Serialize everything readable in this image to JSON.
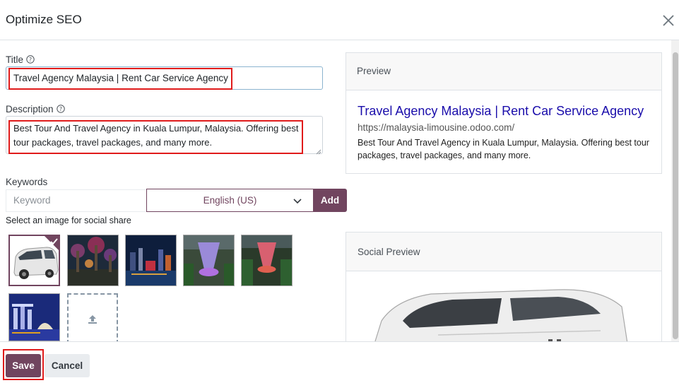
{
  "dialog": {
    "title": "Optimize SEO",
    "close_icon": "close-icon"
  },
  "form": {
    "title_label": "Title",
    "title_value": "Travel Agency Malaysia | Rent Car Service Agency",
    "description_label": "Description",
    "description_value": "Best Tour And Travel Agency in Kuala Lumpur, Malaysia. Offering best tour packages, travel packages, and many more.",
    "help_icon": "question-circle-icon",
    "keywords_label": "Keywords",
    "keyword_placeholder": "Keyword",
    "language_selected": "English (US)",
    "add_label": "Add",
    "image_section_label": "Select an image for social share",
    "images": [
      {
        "name": "white-van",
        "selected": true
      },
      {
        "name": "gardens-by-the-bay-night",
        "selected": false
      },
      {
        "name": "marina-bay-night",
        "selected": false
      },
      {
        "name": "jewel-waterfall-purple",
        "selected": false
      },
      {
        "name": "jewel-waterfall-red",
        "selected": false
      },
      {
        "name": "marina-bay-sands-night",
        "selected": false
      }
    ],
    "upload_icon": "upload-icon"
  },
  "preview": {
    "header": "Preview",
    "title": "Travel Agency Malaysia | Rent Car Service Agency",
    "url": "https://malaysia-limousine.odoo.com/",
    "description": "Best Tour And Travel Agency in Kuala Lumpur, Malaysia. Offering best tour packages, travel packages, and many more."
  },
  "social_preview": {
    "header": "Social Preview"
  },
  "footer": {
    "save_label": "Save",
    "cancel_label": "Cancel"
  },
  "colors": {
    "primary": "#71455f",
    "link": "#1a0dab",
    "highlight": "#e01b1b"
  }
}
